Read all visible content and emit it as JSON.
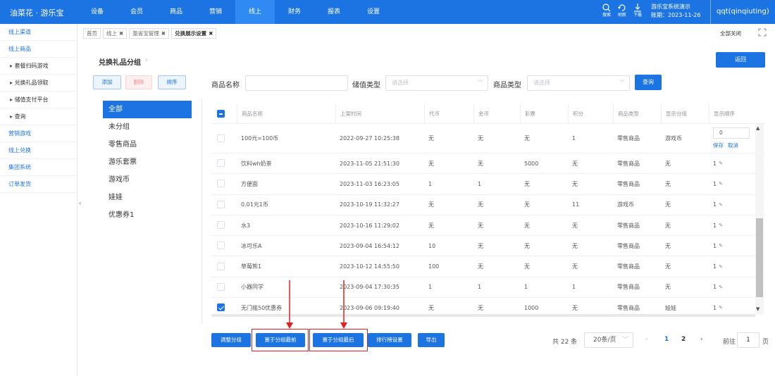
{
  "topbar": {
    "brand": "油菜花 · 游乐宝",
    "nav": [
      "设备",
      "会员",
      "商品",
      "营销",
      "线上",
      "财务",
      "报表",
      "设置"
    ],
    "active_nav": 4,
    "icons": [
      {
        "name": "search-icon",
        "label": "搜索"
      },
      {
        "name": "refresh-icon",
        "label": "刷新"
      },
      {
        "name": "download-icon",
        "label": "下载"
      }
    ],
    "system": "游乐宝系统演示",
    "term": "账期：2023-11-26",
    "user": "qqt(qinqiuting)"
  },
  "sidebar": [
    {
      "label": "线上渠道",
      "sub": false
    },
    {
      "label": "线上商品",
      "sub": false
    },
    {
      "label": "套餐扫码游戏",
      "sub": true
    },
    {
      "label": "兑换礼品领取",
      "sub": true
    },
    {
      "label": "储值支付平台",
      "sub": true
    },
    {
      "label": "查询",
      "sub": true
    },
    {
      "label": "营销游戏",
      "sub": false
    },
    {
      "label": "线上兑换",
      "sub": false
    },
    {
      "label": "集团系统",
      "sub": false
    },
    {
      "label": "订单发货",
      "sub": false
    }
  ],
  "tabs": [
    {
      "label": "首页",
      "closable": false
    },
    {
      "label": "线上",
      "closable": true
    },
    {
      "label": "盈省宝管理",
      "closable": true
    },
    {
      "label": "兑换展示设置",
      "closable": true,
      "active": true
    }
  ],
  "close_all": "全部关闭",
  "page": {
    "title": "兑换礼品分组",
    "back": "返回",
    "buttons": {
      "add": "添加",
      "delete": "删除",
      "sort": "排序"
    },
    "groups": [
      "全部",
      "未分组",
      "零售商品",
      "游乐套票",
      "游戏币",
      "娃娃",
      "优惠券1"
    ],
    "active_group": 0
  },
  "filters": {
    "name_label": "商品名称",
    "name_value": "",
    "store_label": "储值类型",
    "store_placeholder": "请选择",
    "type_label": "商品类型",
    "type_placeholder": "请选择",
    "query": "查询"
  },
  "table": {
    "columns": [
      "商品名称",
      "上架时间",
      "代币",
      "金币",
      "彩票",
      "积分",
      "商品类型",
      "显示分组",
      "显示顺序"
    ],
    "rows": [
      {
        "checked": false,
        "cells": [
          "100元=100币",
          "2022-09-27 10:25:38",
          "无",
          "无",
          "无",
          "1",
          "零售商品",
          "游戏币"
        ],
        "order": "0",
        "editing": true
      },
      {
        "checked": false,
        "cells": [
          "饮料wh奶茶",
          "2023-11-05 21:51:30",
          "无",
          "无",
          "5000",
          "无",
          "零售商品",
          "无"
        ],
        "order": "1"
      },
      {
        "checked": false,
        "cells": [
          "方便面",
          "2023-11-03 16:23:05",
          "1",
          "1",
          "无",
          "无",
          "零售商品",
          "无"
        ],
        "order": "1"
      },
      {
        "checked": false,
        "cells": [
          "0.01元1币",
          "2023-10-19 11:32:27",
          "无",
          "无",
          "无",
          "11",
          "游戏币",
          "无"
        ],
        "order": "1"
      },
      {
        "checked": false,
        "cells": [
          "水3",
          "2023-10-16 11:29:02",
          "无",
          "无",
          "无",
          "无",
          "零售商品",
          "无"
        ],
        "order": "1"
      },
      {
        "checked": false,
        "cells": [
          "冰可乐A",
          "2023-09-04 16:54:12",
          "10",
          "无",
          "无",
          "无",
          "零售商品",
          "无"
        ],
        "order": "1"
      },
      {
        "checked": false,
        "cells": [
          "草莓熊1",
          "2023-10-12 14:55:50",
          "100",
          "无",
          "无",
          "无",
          "零售商品",
          "无"
        ],
        "order": "1"
      },
      {
        "checked": false,
        "cells": [
          "小器同学",
          "2023-09-04 17:30:35",
          "1",
          "1",
          "1",
          "1",
          "零售商品",
          "无"
        ],
        "order": "1"
      },
      {
        "checked": true,
        "cells": [
          "无门槛50优惠券",
          "2023-09-06 09:19:40",
          "无",
          "无",
          "1000",
          "无",
          "零售商品",
          "娃娃"
        ],
        "order": "1"
      }
    ],
    "save": "保存",
    "cancel": "取消"
  },
  "bottom": {
    "buttons": [
      "调整分组",
      "置于分组最前",
      "置于分组最后",
      "排行榜设置",
      "导出"
    ],
    "total": "共 22 条",
    "page_size": "20条/页",
    "pages": [
      "1",
      "2"
    ],
    "current_page": "1",
    "goto": "前往",
    "goto_value": "1",
    "goto_unit": "页"
  },
  "colors": {
    "primary": "#1b74e2",
    "highlight": "#e02020"
  }
}
